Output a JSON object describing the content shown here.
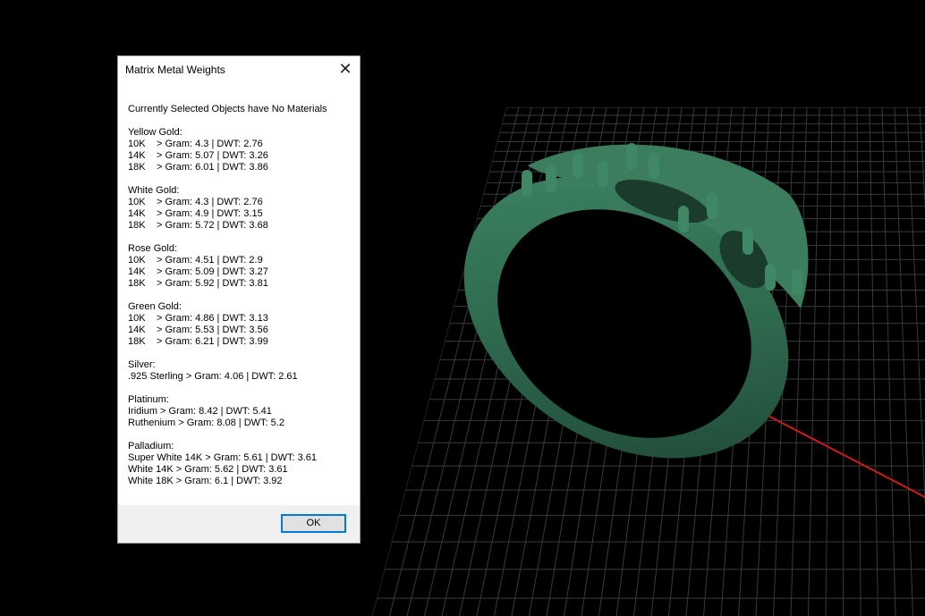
{
  "dialog": {
    "title": "Matrix Metal Weights",
    "close_icon": "close-icon",
    "summary": "Currently Selected Objects have No Materials",
    "ok_label": "OK"
  },
  "metals": {
    "yellow_gold": {
      "name": "Yellow Gold:",
      "rows": [
        {
          "karat": "10K",
          "value": "> Gram: 4.3 | DWT: 2.76"
        },
        {
          "karat": "14K",
          "value": "> Gram: 5.07 | DWT: 3.26"
        },
        {
          "karat": "18K",
          "value": "> Gram: 6.01 | DWT: 3.86"
        }
      ]
    },
    "white_gold": {
      "name": "White Gold:",
      "rows": [
        {
          "karat": "10K",
          "value": "> Gram: 4.3 | DWT: 2.76"
        },
        {
          "karat": "14K",
          "value": "> Gram: 4.9 | DWT: 3.15"
        },
        {
          "karat": "18K",
          "value": "> Gram: 5.72 | DWT: 3.68"
        }
      ]
    },
    "rose_gold": {
      "name": "Rose Gold:",
      "rows": [
        {
          "karat": "10K",
          "value": "> Gram: 4.51 | DWT: 2.9"
        },
        {
          "karat": "14K",
          "value": "> Gram: 5.09 | DWT: 3.27"
        },
        {
          "karat": "18K",
          "value": "> Gram: 5.92 | DWT: 3.81"
        }
      ]
    },
    "green_gold": {
      "name": "Green Gold:",
      "rows": [
        {
          "karat": "10K",
          "value": "> Gram: 4.86 | DWT: 3.13"
        },
        {
          "karat": "14K",
          "value": "> Gram: 5.53 | DWT: 3.56"
        },
        {
          "karat": "18K",
          "value": "> Gram: 6.21 | DWT: 3.99"
        }
      ]
    },
    "silver": {
      "name": "Silver:",
      "lines": [
        ".925 Sterling > Gram: 4.06 | DWT: 2.61"
      ]
    },
    "platinum": {
      "name": "Platinum:",
      "lines": [
        "Iridium > Gram: 8.42 | DWT: 5.41",
        "Ruthenium > Gram: 8.08 | DWT: 5.2"
      ]
    },
    "palladium": {
      "name": "Palladium:",
      "lines": [
        "Super White 14K > Gram: 5.61 | DWT: 3.61",
        "White 14K > Gram: 5.62 | DWT: 3.61",
        "White 18K > Gram: 6.1 | DWT: 3.92"
      ]
    }
  },
  "viewport": {
    "background": "#000000",
    "grid_color": "#3a3a3a",
    "model_color": "#2f6b4f",
    "x_axis_color": "#cc1b1b",
    "y_axis_color": "#1faa1f"
  }
}
